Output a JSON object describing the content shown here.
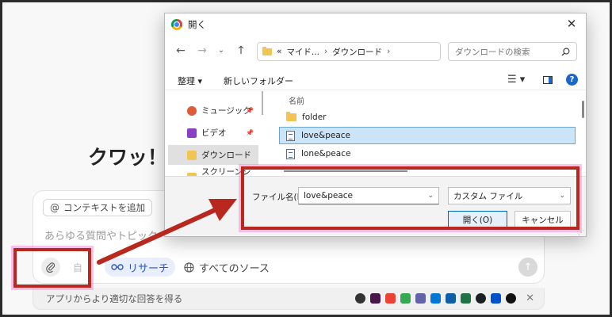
{
  "page": {
    "title": "クワッ！",
    "context_chip": "コンテキストを追加",
    "placeholder": "あらゆる質問やトピック",
    "faded_mode": "自",
    "research_label": "リサーチ",
    "sources_label": "すべてのソース",
    "apps_text": "アプリからより適切な回答を得る",
    "app_icon_colors": [
      "#333333",
      "#4a154b",
      "#ea4335",
      "#34a853",
      "#6264a7",
      "#0078d4",
      "#0f5ea8",
      "#217346",
      "#1b1f23",
      "#0052cc",
      "#111111"
    ]
  },
  "dialog": {
    "title": "開く",
    "address": {
      "prefix": "«",
      "segment1": "マイド...",
      "separator": "›",
      "segment2": "ダウンロード",
      "trailing_separator": "›"
    },
    "search_placeholder": "ダウンロードの検索",
    "organize_label": "整理 ▾",
    "new_folder_label": "新しいフォルダー",
    "sidebar": [
      {
        "label": "ミュージック",
        "icon": "music-icon",
        "color": "#e05a3a"
      },
      {
        "label": "ビデオ",
        "icon": "video-icon",
        "color": "#8a3fc4"
      },
      {
        "label": "ダウンロード",
        "icon": "folder-icon",
        "color": "#f1c453"
      },
      {
        "label": "スクリーンショット",
        "icon": "folder-icon",
        "color": "#f1c453"
      }
    ],
    "column_name": "名前",
    "files": [
      {
        "name": "folder",
        "type": "folder"
      },
      {
        "name": "love&peace",
        "type": "document"
      },
      {
        "name": "lone&peace",
        "type": "document"
      }
    ],
    "filename_label": "ファイル名(N):",
    "filename_value": "love&peace",
    "filetype_value": "カスタム ファイル",
    "open_label": "開く(O)",
    "cancel_label": "キャンセル"
  },
  "annotations": {
    "color": "#b8281e",
    "highlight_color": "#ff78d2"
  }
}
